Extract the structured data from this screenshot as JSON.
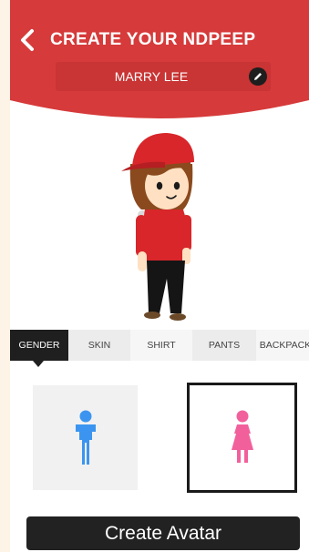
{
  "header": {
    "title": "CREATE YOUR NDPEEP",
    "back_icon": "chevron-left-icon",
    "name_value": "MARRY LEE",
    "edit_icon": "pencil-icon",
    "color": "#d63a3a"
  },
  "tabs": [
    {
      "label": "GENDER",
      "active": true
    },
    {
      "label": "SKIN",
      "active": false
    },
    {
      "label": "SHIRT",
      "active": false
    },
    {
      "label": "PANTS",
      "active": false
    },
    {
      "label": "BACKPACK",
      "active": false
    }
  ],
  "gender": {
    "male_icon": "male-figure-icon",
    "female_icon": "female-figure-icon",
    "male_color": "#3b95f0",
    "female_color": "#f2609c",
    "selected": "female"
  },
  "create_button": "Create Avatar"
}
